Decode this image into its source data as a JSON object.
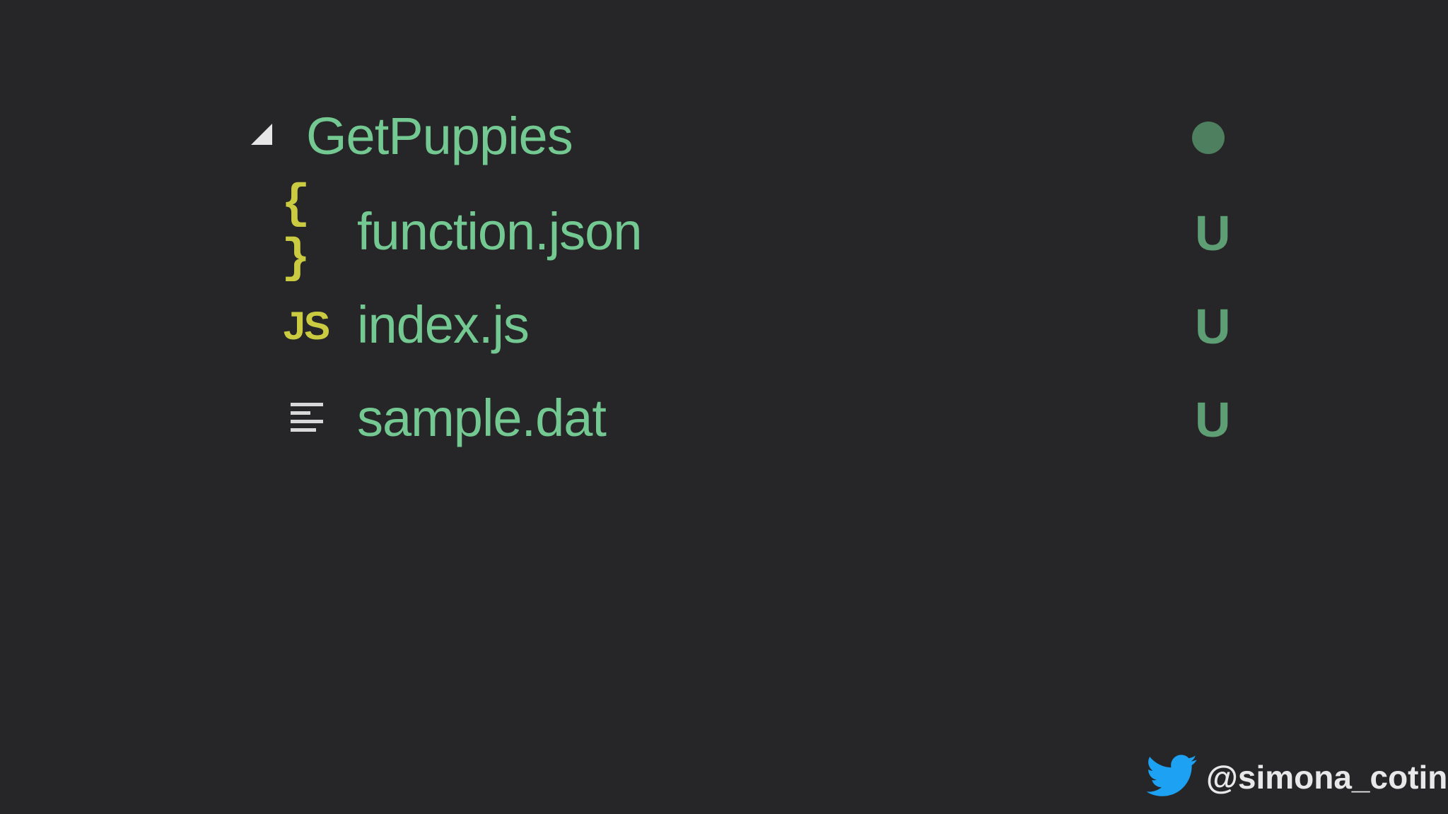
{
  "folder": {
    "name": "GetPuppies",
    "expanded": true,
    "icon": "triangle-expanded-icon",
    "status_indicator": "modified-dot"
  },
  "files": [
    {
      "name": "function.json",
      "icon": "json-braces-icon",
      "icon_text": "{ }",
      "status": "U"
    },
    {
      "name": "index.js",
      "icon": "javascript-icon",
      "icon_text": "JS",
      "status": "U"
    },
    {
      "name": "sample.dat",
      "icon": "text-lines-icon",
      "icon_text": "",
      "status": "U"
    }
  ],
  "footer": {
    "handle": "@simona_cotin",
    "icon": "twitter-bird-icon"
  },
  "colors": {
    "background": "#262628",
    "filename_green": "#73c991",
    "status_green": "#5e9e75",
    "dot_green": "#4e7f5e",
    "icon_yellow": "#cbcb41",
    "twitter_blue": "#1da1f2"
  }
}
